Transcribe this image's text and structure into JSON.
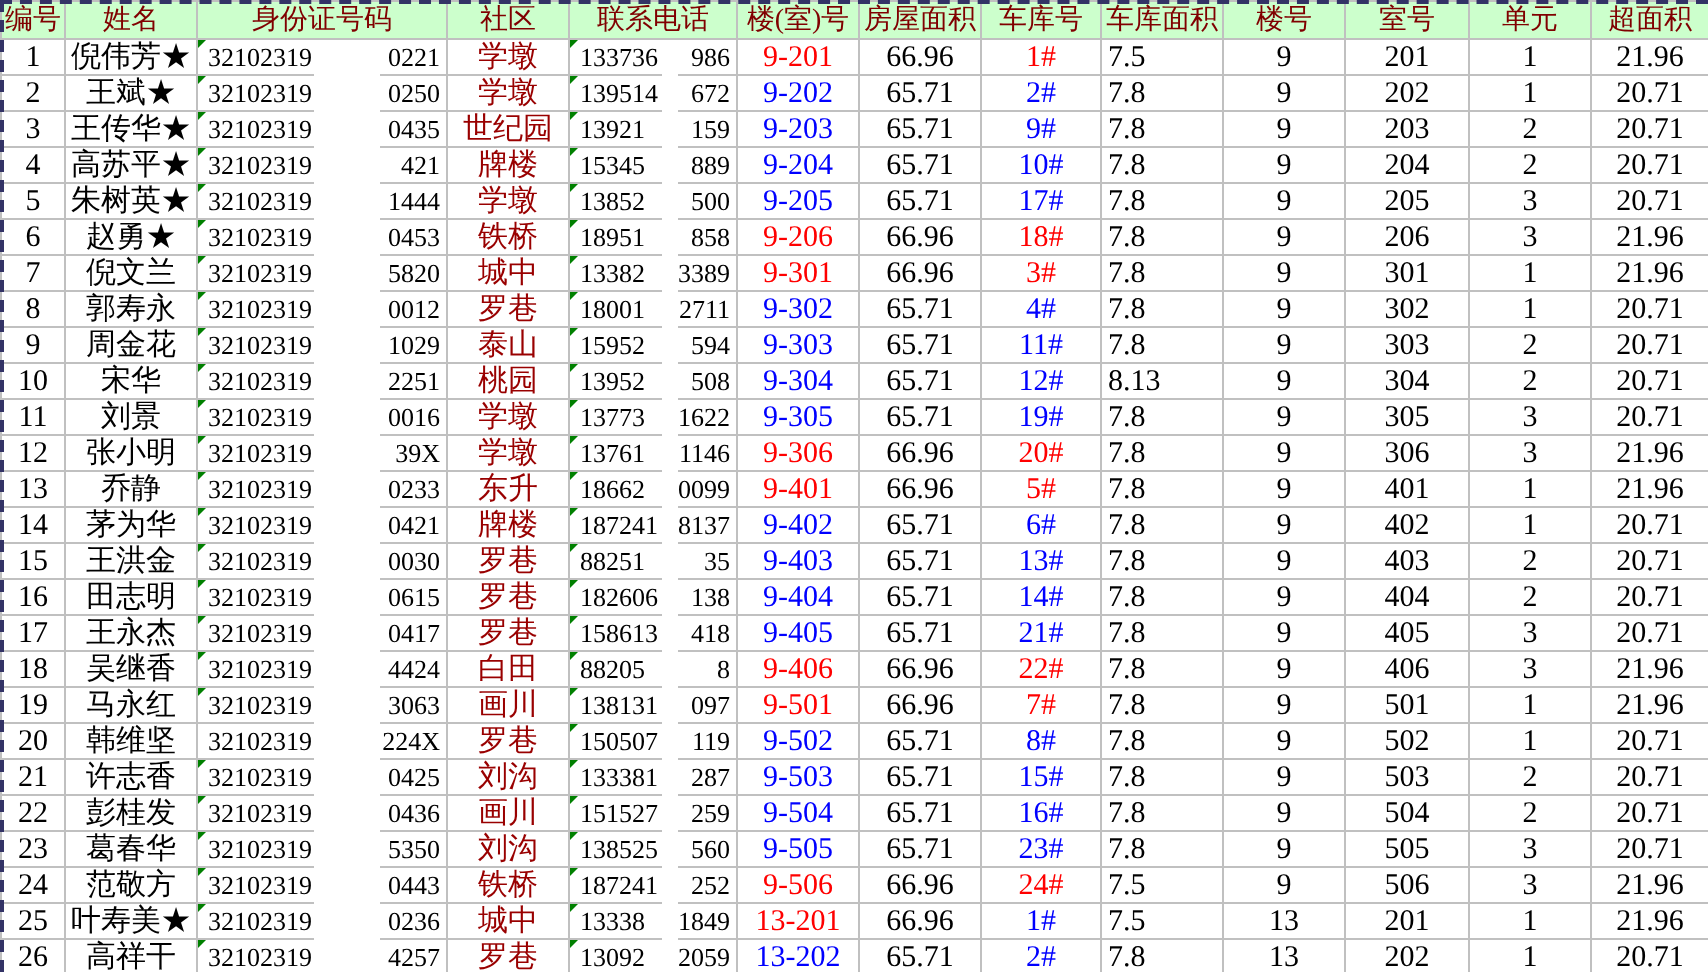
{
  "columns": [
    "编号",
    "姓名",
    "身份证号码",
    "社区",
    "联系电话",
    "楼(室)号",
    "房屋面积",
    "车库号",
    "车库面积",
    "楼号",
    "室号",
    "单元",
    "超面积"
  ],
  "rows": [
    {
      "no": "1",
      "name": "倪伟芳★",
      "id_start": "32102319",
      "id_end": "0221",
      "id_marked": true,
      "community": "学墩",
      "phone_start": "133736",
      "phone_end": "986",
      "room": {
        "text": "9-201",
        "color": "#ff0000"
      },
      "area": "66.96",
      "garage": {
        "text": "1#",
        "color": "#ff0000"
      },
      "garage_area": "7.5",
      "building": "9",
      "room_no": "201",
      "unit": "1",
      "excess": "21.96"
    },
    {
      "no": "2",
      "name": "王斌★",
      "id_start": "32102319",
      "id_end": "0250",
      "id_marked": true,
      "community": "学墩",
      "phone_start": "139514",
      "phone_end": "672",
      "room": {
        "text": "9-202",
        "color": "#0000ff"
      },
      "area": "65.71",
      "garage": {
        "text": "2#",
        "color": "#0000ff"
      },
      "garage_area": "7.8",
      "building": "9",
      "room_no": "202",
      "unit": "1",
      "excess": "20.71"
    },
    {
      "no": "3",
      "name": "王传华★",
      "id_start": "32102319",
      "id_end": "0435",
      "id_marked": true,
      "community": "世纪园",
      "phone_start": "13921",
      "phone_end": "159",
      "room": {
        "text": "9-203",
        "color": "#0000ff"
      },
      "area": "65.71",
      "garage": {
        "text": "9#",
        "color": "#0000ff"
      },
      "garage_area": "7.8",
      "building": "9",
      "room_no": "203",
      "unit": "2",
      "excess": "20.71"
    },
    {
      "no": "4",
      "name": "高苏平★",
      "id_start": "32102319",
      "id_end": "421",
      "id_marked": true,
      "community": "牌楼",
      "phone_start": "15345",
      "phone_end": "889",
      "room": {
        "text": "9-204",
        "color": "#0000ff"
      },
      "area": "65.71",
      "garage": {
        "text": "10#",
        "color": "#0000ff"
      },
      "garage_area": "7.8",
      "building": "9",
      "room_no": "204",
      "unit": "2",
      "excess": "20.71"
    },
    {
      "no": "5",
      "name": "朱树英★",
      "id_start": "32102319",
      "id_end": "1444",
      "id_marked": true,
      "community": "学墩",
      "phone_start": "13852",
      "phone_end": "500",
      "room": {
        "text": "9-205",
        "color": "#0000ff"
      },
      "area": "65.71",
      "garage": {
        "text": "17#",
        "color": "#0000ff"
      },
      "garage_area": "7.8",
      "building": "9",
      "room_no": "205",
      "unit": "3",
      "excess": "20.71"
    },
    {
      "no": "6",
      "name": "赵勇★",
      "id_start": "32102319",
      "id_end": "0453",
      "id_marked": true,
      "community": "铁桥",
      "phone_start": "18951",
      "phone_end": "858",
      "room": {
        "text": "9-206",
        "color": "#ff0000"
      },
      "area": "66.96",
      "garage": {
        "text": "18#",
        "color": "#ff0000"
      },
      "garage_area": "7.8",
      "building": "9",
      "room_no": "206",
      "unit": "3",
      "excess": "21.96"
    },
    {
      "no": "7",
      "name": "倪文兰",
      "id_start": "32102319",
      "id_end": "5820",
      "id_marked": true,
      "community": "城中",
      "phone_start": "13382",
      "phone_end": "3389",
      "room": {
        "text": "9-301",
        "color": "#ff0000"
      },
      "area": "66.96",
      "garage": {
        "text": "3#",
        "color": "#ff0000"
      },
      "garage_area": "7.8",
      "building": "9",
      "room_no": "301",
      "unit": "1",
      "excess": "21.96"
    },
    {
      "no": "8",
      "name": "郭寿永",
      "id_start": "32102319",
      "id_end": "0012",
      "id_marked": true,
      "community": "罗巷",
      "phone_start": "18001",
      "phone_end": "2711",
      "room": {
        "text": "9-302",
        "color": "#0000ff"
      },
      "area": "65.71",
      "garage": {
        "text": "4#",
        "color": "#0000ff"
      },
      "garage_area": "7.8",
      "building": "9",
      "room_no": "302",
      "unit": "1",
      "excess": "20.71"
    },
    {
      "no": "9",
      "name": "周金花",
      "id_start": "32102319",
      "id_end": "1029",
      "id_marked": true,
      "community": "泰山",
      "phone_start": "15952",
      "phone_end": "594",
      "room": {
        "text": "9-303",
        "color": "#0000ff"
      },
      "area": "65.71",
      "garage": {
        "text": "11#",
        "color": "#0000ff"
      },
      "garage_area": "7.8",
      "building": "9",
      "room_no": "303",
      "unit": "2",
      "excess": "20.71"
    },
    {
      "no": "10",
      "name": "宋华",
      "id_start": "32102319",
      "id_end": "2251",
      "id_marked": true,
      "community": "桃园",
      "phone_start": "13952",
      "phone_end": "508",
      "room": {
        "text": "9-304",
        "color": "#0000ff"
      },
      "area": "65.71",
      "garage": {
        "text": "12#",
        "color": "#0000ff"
      },
      "garage_area": "8.13",
      "building": "9",
      "room_no": "304",
      "unit": "2",
      "excess": "20.71"
    },
    {
      "no": "11",
      "name": "刘景",
      "id_start": "32102319",
      "id_end": "0016",
      "id_marked": true,
      "community": "学墩",
      "phone_start": "13773",
      "phone_end": "1622",
      "room": {
        "text": "9-305",
        "color": "#0000ff"
      },
      "area": "65.71",
      "garage": {
        "text": "19#",
        "color": "#0000ff"
      },
      "garage_area": "7.8",
      "building": "9",
      "room_no": "305",
      "unit": "3",
      "excess": "20.71"
    },
    {
      "no": "12",
      "name": "张小明",
      "id_start": "32102319",
      "id_end": "39X",
      "id_marked": true,
      "community": "学墩",
      "phone_start": "13761",
      "phone_end": "1146",
      "room": {
        "text": "9-306",
        "color": "#ff0000"
      },
      "area": "66.96",
      "garage": {
        "text": "20#",
        "color": "#ff0000"
      },
      "garage_area": "7.8",
      "building": "9",
      "room_no": "306",
      "unit": "3",
      "excess": "21.96"
    },
    {
      "no": "13",
      "name": "乔静",
      "id_start": "32102319",
      "id_end": "0233",
      "id_marked": true,
      "community": "东升",
      "phone_start": "18662",
      "phone_end": "0099",
      "room": {
        "text": "9-401",
        "color": "#ff0000"
      },
      "area": "66.96",
      "garage": {
        "text": "5#",
        "color": "#ff0000"
      },
      "garage_area": "7.8",
      "building": "9",
      "room_no": "401",
      "unit": "1",
      "excess": "21.96"
    },
    {
      "no": "14",
      "name": "茅为华",
      "id_start": "32102319",
      "id_end": "0421",
      "id_marked": true,
      "community": "牌楼",
      "phone_start": "187241",
      "phone_end": "8137",
      "room": {
        "text": "9-402",
        "color": "#0000ff"
      },
      "area": "65.71",
      "garage": {
        "text": "6#",
        "color": "#0000ff"
      },
      "garage_area": "7.8",
      "building": "9",
      "room_no": "402",
      "unit": "1",
      "excess": "20.71"
    },
    {
      "no": "15",
      "name": "王洪金",
      "id_start": "32102319",
      "id_end": "0030",
      "id_marked": true,
      "community": "罗巷",
      "phone_start": "88251",
      "phone_end": "35",
      "room": {
        "text": "9-403",
        "color": "#0000ff"
      },
      "area": "65.71",
      "garage": {
        "text": "13#",
        "color": "#0000ff"
      },
      "garage_area": "7.8",
      "building": "9",
      "room_no": "403",
      "unit": "2",
      "excess": "20.71"
    },
    {
      "no": "16",
      "name": "田志明",
      "id_start": "32102319",
      "id_end": "0615",
      "id_marked": true,
      "community": "罗巷",
      "phone_start": "182606",
      "phone_end": "138",
      "room": {
        "text": "9-404",
        "color": "#0000ff"
      },
      "area": "65.71",
      "garage": {
        "text": "14#",
        "color": "#0000ff"
      },
      "garage_area": "7.8",
      "building": "9",
      "room_no": "404",
      "unit": "2",
      "excess": "20.71"
    },
    {
      "no": "17",
      "name": "王永杰",
      "id_start": "32102319",
      "id_end": "0417",
      "id_marked": true,
      "community": "罗巷",
      "phone_start": "158613",
      "phone_end": "418",
      "room": {
        "text": "9-405",
        "color": "#0000ff"
      },
      "area": "65.71",
      "garage": {
        "text": "21#",
        "color": "#0000ff"
      },
      "garage_area": "7.8",
      "building": "9",
      "room_no": "405",
      "unit": "3",
      "excess": "20.71"
    },
    {
      "no": "18",
      "name": "吴继香",
      "id_start": "32102319",
      "id_end": "4424",
      "id_marked": true,
      "community": "白田",
      "phone_start": "88205",
      "phone_end": "8",
      "room": {
        "text": "9-406",
        "color": "#ff0000"
      },
      "area": "66.96",
      "garage": {
        "text": "22#",
        "color": "#ff0000"
      },
      "garage_area": "7.8",
      "building": "9",
      "room_no": "406",
      "unit": "3",
      "excess": "21.96"
    },
    {
      "no": "19",
      "name": "马永红",
      "id_start": "32102319",
      "id_end": "3063",
      "id_marked": true,
      "community": "画川",
      "phone_start": "138131",
      "phone_end": "097",
      "room": {
        "text": "9-501",
        "color": "#ff0000"
      },
      "area": "66.96",
      "garage": {
        "text": "7#",
        "color": "#ff0000"
      },
      "garage_area": "7.8",
      "building": "9",
      "room_no": "501",
      "unit": "1",
      "excess": "21.96"
    },
    {
      "no": "20",
      "name": "韩维坚",
      "id_start": "32102319",
      "id_end": "224X",
      "id_marked": false,
      "community": "罗巷",
      "phone_start": "150507",
      "phone_end": "119",
      "room": {
        "text": "9-502",
        "color": "#0000ff"
      },
      "area": "65.71",
      "garage": {
        "text": "8#",
        "color": "#0000ff"
      },
      "garage_area": "7.8",
      "building": "9",
      "room_no": "502",
      "unit": "1",
      "excess": "20.71"
    },
    {
      "no": "21",
      "name": "许志香",
      "id_start": "32102319",
      "id_end": "0425",
      "id_marked": true,
      "community": "刘沟",
      "phone_start": "133381",
      "phone_end": "287",
      "room": {
        "text": "9-503",
        "color": "#0000ff"
      },
      "area": "65.71",
      "garage": {
        "text": "15#",
        "color": "#0000ff"
      },
      "garage_area": "7.8",
      "building": "9",
      "room_no": "503",
      "unit": "2",
      "excess": "20.71"
    },
    {
      "no": "22",
      "name": "彭桂发",
      "id_start": "32102319",
      "id_end": "0436",
      "id_marked": true,
      "community": "画川",
      "phone_start": "151527",
      "phone_end": "259",
      "room": {
        "text": "9-504",
        "color": "#0000ff"
      },
      "area": "65.71",
      "garage": {
        "text": "16#",
        "color": "#0000ff"
      },
      "garage_area": "7.8",
      "building": "9",
      "room_no": "504",
      "unit": "2",
      "excess": "20.71"
    },
    {
      "no": "23",
      "name": "葛春华",
      "id_start": "32102319",
      "id_end": "5350",
      "id_marked": true,
      "community": "刘沟",
      "phone_start": "138525",
      "phone_end": "560",
      "room": {
        "text": "9-505",
        "color": "#0000ff"
      },
      "area": "65.71",
      "garage": {
        "text": "23#",
        "color": "#0000ff"
      },
      "garage_area": "7.8",
      "building": "9",
      "room_no": "505",
      "unit": "3",
      "excess": "20.71"
    },
    {
      "no": "24",
      "name": "范敬方",
      "id_start": "32102319",
      "id_end": "0443",
      "id_marked": true,
      "community": "铁桥",
      "phone_start": "187241",
      "phone_end": "252",
      "room": {
        "text": "9-506",
        "color": "#ff0000"
      },
      "area": "66.96",
      "garage": {
        "text": "24#",
        "color": "#ff0000"
      },
      "garage_area": "7.5",
      "building": "9",
      "room_no": "506",
      "unit": "3",
      "excess": "21.96"
    },
    {
      "no": "25",
      "name": "叶寿美★",
      "id_start": "32102319",
      "id_end": "0236",
      "id_marked": true,
      "community": "城中",
      "phone_start": "13338",
      "phone_end": "1849",
      "room": {
        "text": "13-201",
        "color": "#ff0000"
      },
      "area": "66.96",
      "garage": {
        "text": "1#",
        "color": "#0000ff"
      },
      "garage_area": "7.5",
      "building": "13",
      "room_no": "201",
      "unit": "1",
      "excess": "21.96"
    },
    {
      "no": "26",
      "name": "高祥干",
      "id_start": "32102319",
      "id_end": "4257",
      "id_marked": true,
      "community": "罗巷",
      "phone_start": "13092",
      "phone_end": "2059",
      "room": {
        "text": "13-202",
        "color": "#0000ff"
      },
      "area": "65.71",
      "garage": {
        "text": "2#",
        "color": "#0000ff"
      },
      "garage_area": "7.8",
      "building": "13",
      "room_no": "202",
      "unit": "1",
      "excess": "20.71"
    }
  ]
}
